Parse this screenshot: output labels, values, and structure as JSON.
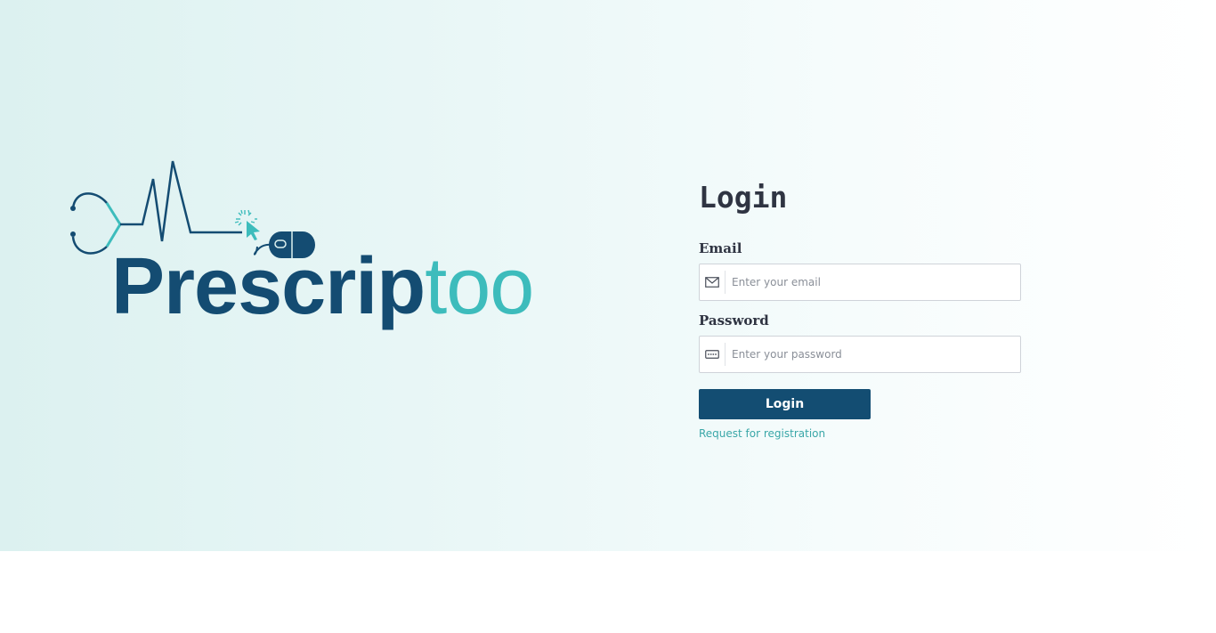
{
  "logo": {
    "word_dark": "Prescrip",
    "word_teal": "too",
    "colors": {
      "dark": "#144c72",
      "teal": "#3dbcbc"
    },
    "icons": [
      "stethoscope-icon",
      "heartbeat-line-icon",
      "cursor-click-icon",
      "computer-mouse-icon"
    ]
  },
  "login": {
    "title": "Login",
    "email": {
      "label": "Email",
      "placeholder": "Enter your email",
      "value": "",
      "icon": "envelope-icon"
    },
    "password": {
      "label": "Password",
      "placeholder": "Enter your password",
      "value": "",
      "icon": "password-dots-icon"
    },
    "submit_label": "Login",
    "register_link": "Request for registration"
  },
  "colors": {
    "primary": "#134d72",
    "accent": "#3aa7a8",
    "background_left": "#dcf1f0",
    "background_right": "#ffffff"
  }
}
